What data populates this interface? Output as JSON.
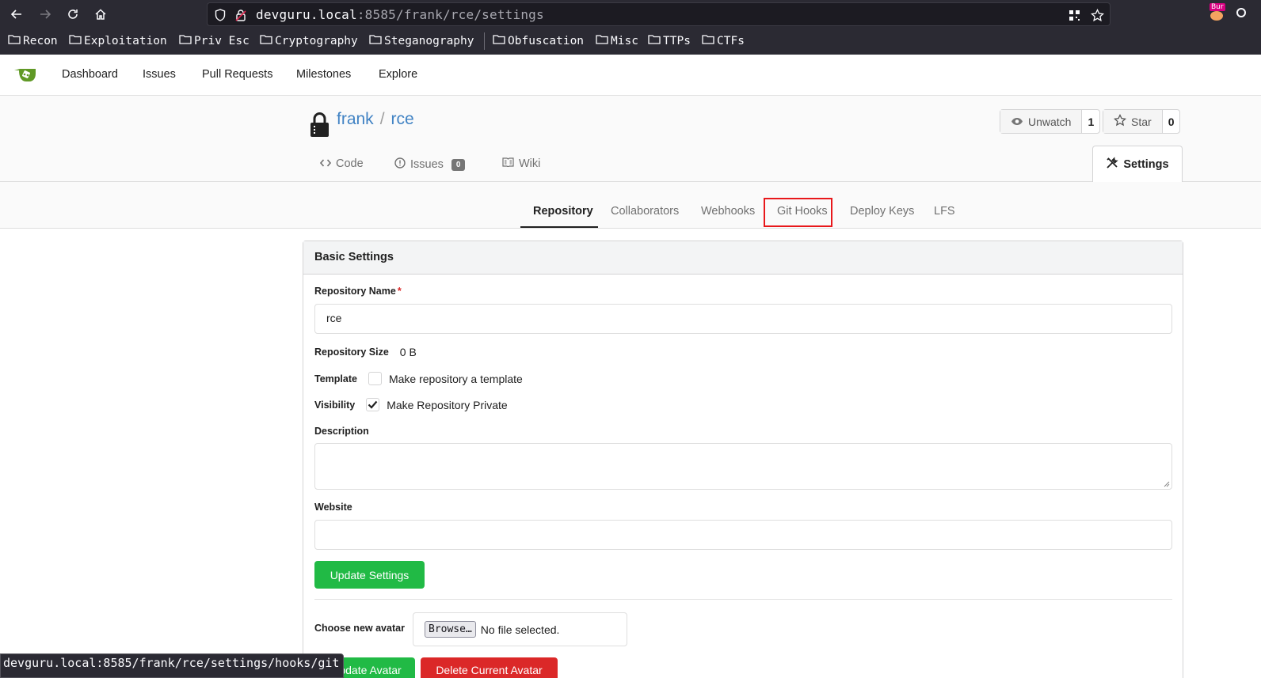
{
  "browser": {
    "url_host": "devguru.local",
    "url_rest": ":8585/frank/rce/settings",
    "bookmarks": [
      "Recon",
      "Exploitation",
      "Priv Esc",
      "Cryptography",
      "Steganography",
      "Obfuscation",
      "Misc",
      "TTPs",
      "CTFs"
    ],
    "extension_badge": "Bur",
    "status_url": "devguru.local:8585/frank/rce/settings/hooks/git"
  },
  "topnav": {
    "items": [
      "Dashboard",
      "Issues",
      "Pull Requests",
      "Milestones",
      "Explore"
    ]
  },
  "repo": {
    "owner": "frank",
    "separator": "/",
    "name": "rce",
    "watch_label": "Unwatch",
    "watch_count": "1",
    "star_label": "Star",
    "star_count": "0",
    "tabs": {
      "code": "Code",
      "issues": "Issues",
      "issues_count": "0",
      "wiki": "Wiki",
      "settings": "Settings"
    }
  },
  "settings_nav": {
    "items": [
      "Repository",
      "Collaborators",
      "Webhooks",
      "Git Hooks",
      "Deploy Keys",
      "LFS"
    ],
    "active": "Repository",
    "highlighted": "Git Hooks"
  },
  "basic_settings": {
    "title": "Basic Settings",
    "repo_name_label": "Repository Name",
    "required_mark": "*",
    "repo_name_value": "rce",
    "repo_size_label": "Repository Size",
    "repo_size_value": "0 B",
    "template_label": "Template",
    "template_checkbox_label": "Make repository a template",
    "template_checked": false,
    "visibility_label": "Visibility",
    "visibility_checkbox_label": "Make Repository Private",
    "visibility_checked": true,
    "description_label": "Description",
    "description_value": "",
    "website_label": "Website",
    "website_value": "",
    "update_button": "Update Settings",
    "avatar_label": "Choose new avatar",
    "browse_button": "Browse…",
    "no_file_text": "No file selected.",
    "update_avatar_button": "Update Avatar",
    "delete_avatar_button": "Delete Current Avatar"
  },
  "colors": {
    "link": "#4183c4",
    "green": "#21ba45",
    "red": "#db2828",
    "highlight": "#e8181b",
    "chrome": "#2b2a33"
  }
}
